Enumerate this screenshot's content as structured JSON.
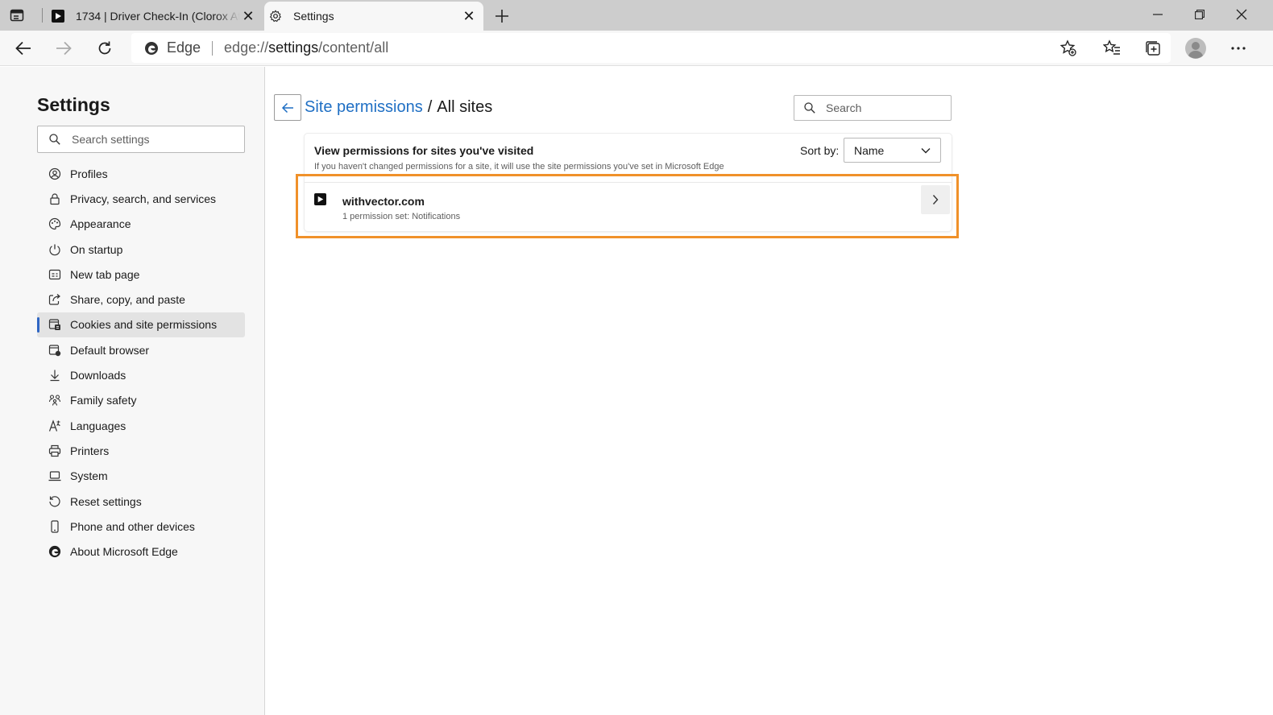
{
  "browser": {
    "tabs": [
      {
        "title": "1734 | Driver Check-In (Clorox At",
        "active": false
      },
      {
        "title": "Settings",
        "active": true
      }
    ],
    "address": {
      "brand": "Edge",
      "url_prefix": "edge://",
      "url_host": "settings",
      "url_path": "/content/all"
    }
  },
  "sidebar": {
    "title": "Settings",
    "search_placeholder": "Search settings",
    "items": [
      {
        "label": "Profiles",
        "icon": "profile-icon"
      },
      {
        "label": "Privacy, search, and services",
        "icon": "lock-icon"
      },
      {
        "label": "Appearance",
        "icon": "palette-icon"
      },
      {
        "label": "On startup",
        "icon": "power-icon"
      },
      {
        "label": "New tab page",
        "icon": "new-tab-icon"
      },
      {
        "label": "Share, copy, and paste",
        "icon": "share-icon"
      },
      {
        "label": "Cookies and site permissions",
        "icon": "cookie-icon",
        "selected": true
      },
      {
        "label": "Default browser",
        "icon": "browser-icon"
      },
      {
        "label": "Downloads",
        "icon": "download-icon"
      },
      {
        "label": "Family safety",
        "icon": "family-icon"
      },
      {
        "label": "Languages",
        "icon": "language-icon"
      },
      {
        "label": "Printers",
        "icon": "printer-icon"
      },
      {
        "label": "System",
        "icon": "laptop-icon"
      },
      {
        "label": "Reset settings",
        "icon": "reset-icon"
      },
      {
        "label": "Phone and other devices",
        "icon": "phone-icon"
      },
      {
        "label": "About Microsoft Edge",
        "icon": "edge-logo-icon"
      }
    ]
  },
  "main": {
    "breadcrumb_link": "Site permissions",
    "breadcrumb_sep": "/",
    "breadcrumb_current": "All sites",
    "search_placeholder": "Search",
    "card_title": "View permissions for sites you've visited",
    "card_subtitle": "If you haven't changed permissions for a site, it will use the site permissions you've set in Microsoft Edge",
    "sort_label": "Sort by:",
    "sort_value": "Name",
    "sites": [
      {
        "name": "withvector.com",
        "permissions": "1 permission set: Notifications"
      }
    ]
  },
  "colors": {
    "accent": "#1f6fc4",
    "highlight": "#f0912a",
    "selected_bar": "#2f66c3"
  }
}
